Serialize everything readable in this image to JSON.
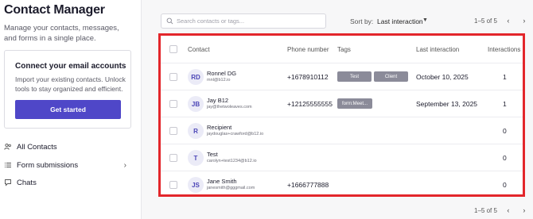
{
  "sidebar": {
    "brand": "Contact Manager",
    "tagline": "Manage your contacts, messages, and forms in a single place.",
    "card": {
      "title": "Connect your email accounts",
      "text": "Import your existing contacts. Unlock tools to stay organized and efficient.",
      "button": "Get started"
    },
    "nav": [
      {
        "label": "All Contacts",
        "icon": "people-icon"
      },
      {
        "label": "Form submissions",
        "icon": "list-icon"
      },
      {
        "label": "Chats",
        "icon": "chat-icon"
      }
    ]
  },
  "toolbar": {
    "search_placeholder": "Search contacts or tags...",
    "sort_label": "Sort by:",
    "sort_value": "Last interaction"
  },
  "pagination": {
    "range": "1–5 of 5"
  },
  "table": {
    "columns": [
      "Contact",
      "Phone number",
      "Tags",
      "Last interaction",
      "Interactions"
    ],
    "rows": [
      {
        "initials": "RD",
        "name": "Ronnel DG",
        "email": "mnl@b12.io",
        "phone": "+1678910112",
        "tags": [
          "Test",
          "Client"
        ],
        "last": "October 10, 2025",
        "count": "1"
      },
      {
        "initials": "JB",
        "name": "Jay B12",
        "email": "jay@thetwoleaves.com",
        "phone": "+12125555555",
        "tags": [
          "form:Meet..."
        ],
        "last": "September 13, 2025",
        "count": "1"
      },
      {
        "initials": "R",
        "name": "Recipient",
        "email": "jaydouglas+crawford@b12.io",
        "phone": "",
        "tags": [],
        "last": "",
        "count": "0"
      },
      {
        "initials": "T",
        "name": "Test",
        "email": "carolyn+test1234@b12.io",
        "phone": "",
        "tags": [],
        "last": "",
        "count": "0"
      },
      {
        "initials": "JS",
        "name": "Jane Smith",
        "email": "janesmith@gggmail.com",
        "phone": "+1666777888",
        "tags": [],
        "last": "",
        "count": "0"
      }
    ]
  },
  "colors": {
    "accent": "#4f47c8",
    "highlight_border": "#e3262b",
    "tag_bg": "#8b8b99",
    "avatar_bg": "#ebebf7"
  }
}
